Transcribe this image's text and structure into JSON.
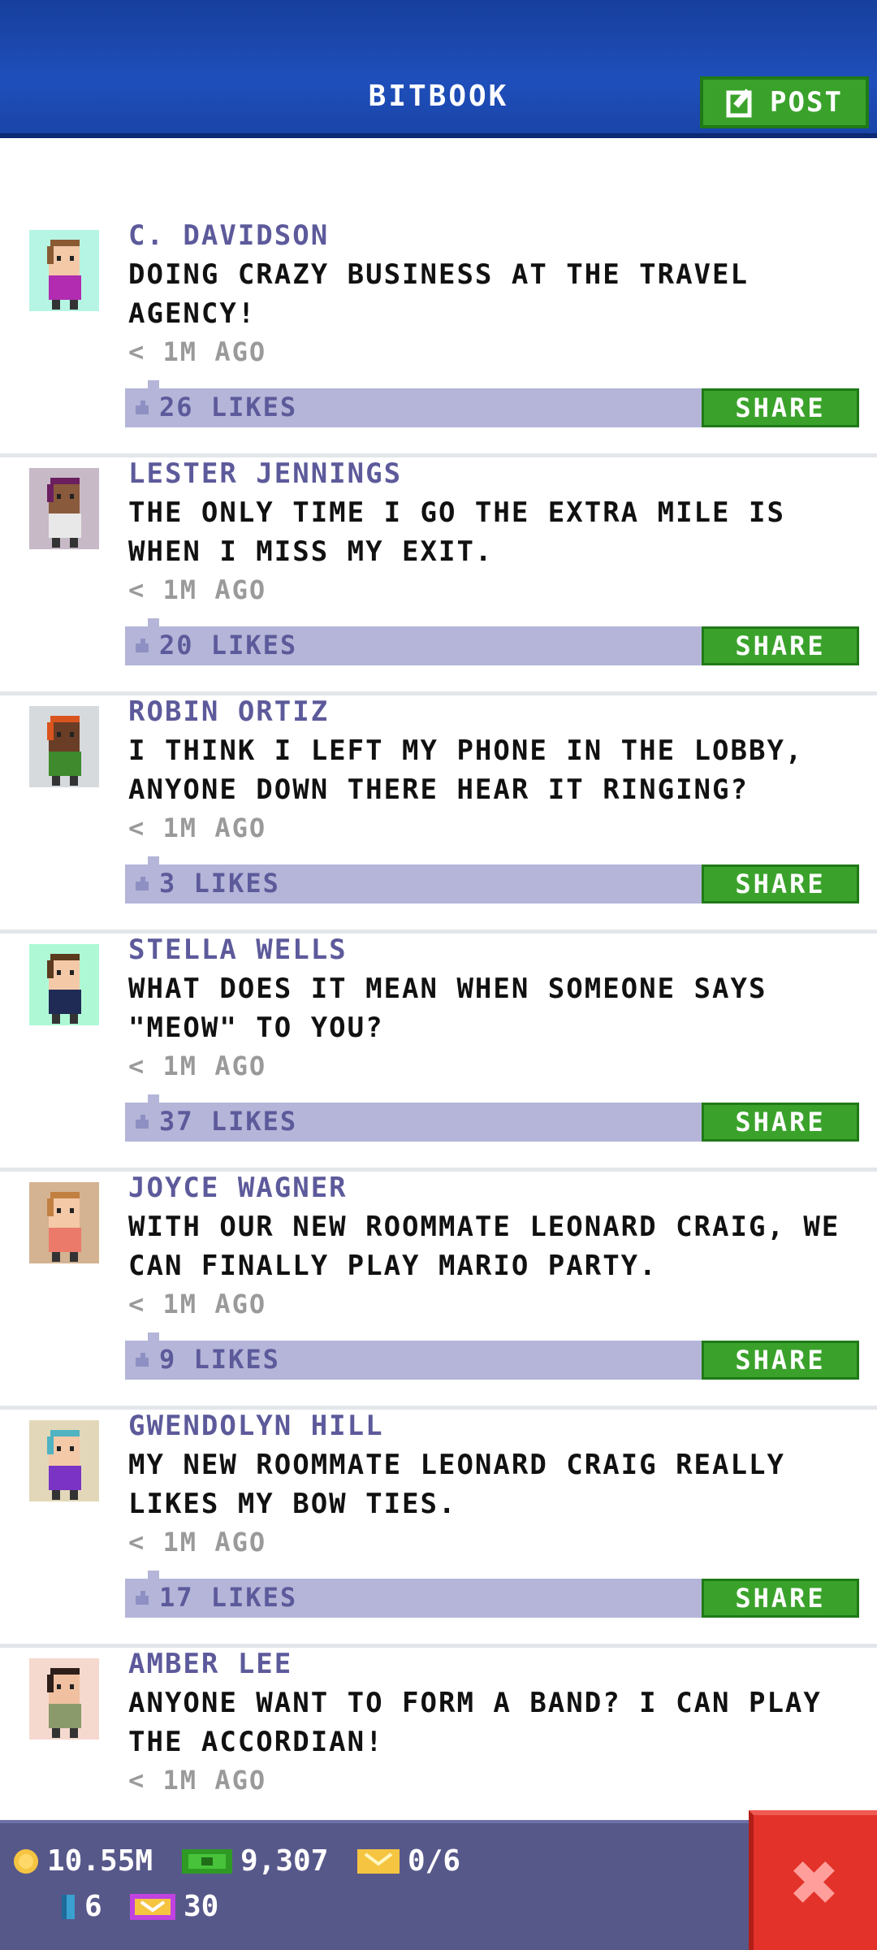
{
  "header": {
    "title": "BITBOOK",
    "post_label": "POST",
    "post_icon": "edit-icon"
  },
  "feed": [
    {
      "author": "C. DAVIDSON",
      "message": "DOING CRAZY BUSINESS AT THE TRAVEL AGENCY!",
      "time": "< 1M AGO",
      "likes": "26 LIKES",
      "share": "SHARE",
      "avatar_bg": "#b6f5e3",
      "shirt": "#b12cb0",
      "hair": "#8a5a32",
      "skin": "#f3c9a8"
    },
    {
      "author": "LESTER JENNINGS",
      "message": "THE ONLY TIME I GO THE EXTRA MILE IS WHEN I MISS MY EXIT.",
      "time": "< 1M AGO",
      "likes": "20 LIKES",
      "share": "SHARE",
      "avatar_bg": "#c8b9c7",
      "shirt": "#e8e8e8",
      "hair": "#6b1f5f",
      "skin": "#8a5a3c"
    },
    {
      "author": "ROBIN ORTIZ",
      "message": "I THINK I LEFT MY PHONE IN THE LOBBY, ANYONE DOWN THERE HEAR IT RINGING?",
      "time": "< 1M AGO",
      "likes": "3 LIKES",
      "share": "SHARE",
      "avatar_bg": "#d6dadd",
      "shirt": "#3e8a2d",
      "hair": "#d9541e",
      "skin": "#6a3d26"
    },
    {
      "author": "STELLA WELLS",
      "message": "WHAT DOES IT MEAN WHEN SOMEONE SAYS \"MEOW\" TO YOU?",
      "time": "< 1M AGO",
      "likes": "37 LIKES",
      "share": "SHARE",
      "avatar_bg": "#aef8d6",
      "shirt": "#1f2b55",
      "hair": "#5b3a1e",
      "skin": "#f3c9a8"
    },
    {
      "author": "JOYCE WAGNER",
      "message": "WITH OUR NEW ROOMMATE LEONARD CRAIG, WE CAN FINALLY PLAY MARIO PARTY.",
      "time": "< 1M AGO",
      "likes": "9 LIKES",
      "share": "SHARE",
      "avatar_bg": "#d4b392",
      "shirt": "#ec7a6a",
      "hair": "#c28040",
      "skin": "#f3c9a8"
    },
    {
      "author": "GWENDOLYN HILL",
      "message": "MY NEW ROOMMATE LEONARD CRAIG REALLY LIKES MY BOW TIES.",
      "time": "< 1M AGO",
      "likes": "17 LIKES",
      "share": "SHARE",
      "avatar_bg": "#e2d8b9",
      "shirt": "#7a33c4",
      "hair": "#4fb3c2",
      "skin": "#f3c9a8"
    },
    {
      "author": "AMBER LEE",
      "message": "ANYONE WANT TO FORM A BAND? I CAN PLAY THE ACCORDIAN!",
      "time": "< 1M AGO",
      "likes": "",
      "share": "",
      "avatar_bg": "#f5d9cf",
      "shirt": "#8a9a6a",
      "hair": "#2e1f1a",
      "skin": "#f0c0a0"
    }
  ],
  "status": {
    "coins": "10.55M",
    "bux": "9,307",
    "tickets": "0/6",
    "items": "6",
    "golden": "30"
  },
  "close_icon": "close-icon",
  "colors": {
    "header_blue": "#1f4fbb",
    "green": "#3aa22b",
    "likes_bar": "#b4b5d8",
    "name_purple": "#5d5a9b",
    "status_bar": "#57588a",
    "close_red": "#e2322a"
  }
}
